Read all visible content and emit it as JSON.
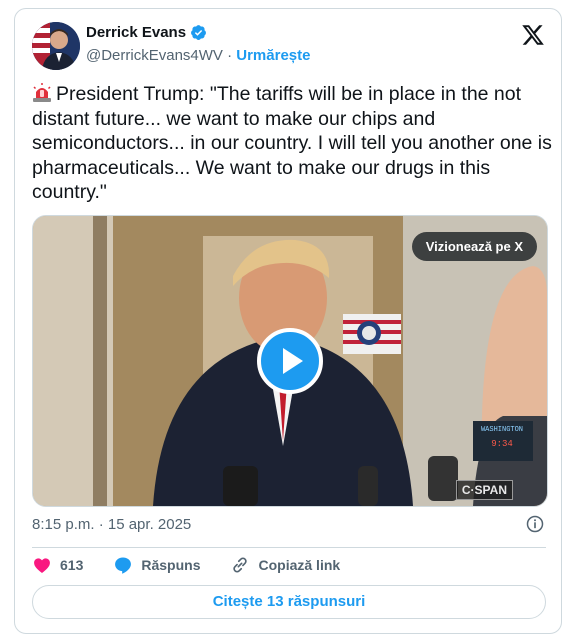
{
  "author": {
    "name": "Derrick Evans",
    "handle": "@DerrickEvans4WV",
    "separator": "·",
    "follow_label": "Urmărește"
  },
  "tweet": {
    "text": "President Trump: \"The tariffs will be in place in the not distant future... we want to make our chips and semiconductors... in our country. I will tell you another one is pharmaceuticals... We want to make our drugs in this country.\""
  },
  "media": {
    "watch_label": "Vizionează pe X",
    "network_logo": "C·SPAN",
    "clock_label": "WASHINGTON",
    "clock_time": "9:34"
  },
  "meta": {
    "timestamp": "8:15 p.m. · 15 apr. 2025"
  },
  "actions": {
    "likes": "613",
    "reply_label": "Răspuns",
    "copy_label": "Copiază link"
  },
  "replies_button": "Citește 13 răspunsuri",
  "colors": {
    "accent": "#1d9bf0",
    "like": "#f91880",
    "text": "#0f1419",
    "muted": "#536471"
  }
}
